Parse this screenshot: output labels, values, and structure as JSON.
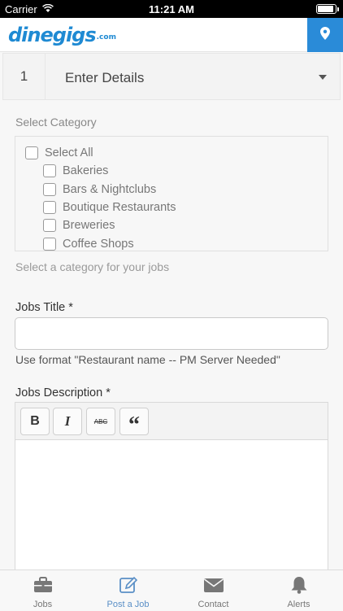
{
  "status_bar": {
    "carrier": "Carrier",
    "time": "11:21 AM",
    "battery_level": 0.9
  },
  "header": {
    "logo_main": "dinegigs",
    "logo_suffix": ".com",
    "location_icon": "map-pin-icon"
  },
  "step": {
    "number": "1",
    "title": "Enter Details"
  },
  "form": {
    "category_label": "Select Category",
    "categories": [
      {
        "label": "Select All",
        "checked": false
      },
      {
        "label": "Bakeries",
        "checked": false
      },
      {
        "label": "Bars & Nightclubs",
        "checked": false
      },
      {
        "label": "Boutique Restaurants",
        "checked": false
      },
      {
        "label": "Breweries",
        "checked": false
      },
      {
        "label": "Coffee Shops",
        "checked": false
      }
    ],
    "category_helper": "Select a category for your jobs",
    "title_label": "Jobs Title *",
    "title_value": "",
    "title_helper": "Use format \"Restaurant name -- PM Server Needed\"",
    "description_label": "Jobs Description *",
    "toolbar": {
      "bold": "B",
      "italic": "I",
      "strike": "ABC",
      "quote": "“"
    }
  },
  "tabs": [
    {
      "label": "Jobs",
      "icon": "briefcase-icon",
      "active": false
    },
    {
      "label": "Post a Job",
      "icon": "edit-icon",
      "active": true
    },
    {
      "label": "Contact",
      "icon": "envelope-icon",
      "active": false
    },
    {
      "label": "Alerts",
      "icon": "bell-icon",
      "active": false
    }
  ],
  "colors": {
    "brand": "#1f8ad3",
    "location_button": "#2a8bd8",
    "active_tab": "#5a8fc6"
  }
}
